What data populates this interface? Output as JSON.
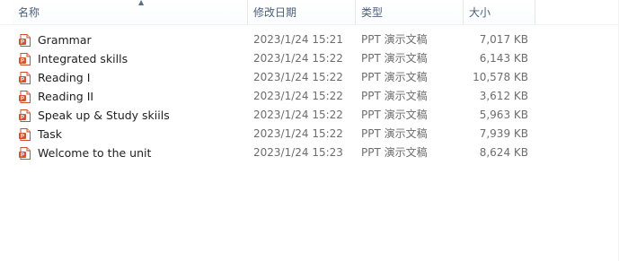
{
  "columns": {
    "name": "名称",
    "date": "修改日期",
    "type": "类型",
    "size": "大小"
  },
  "icon": "powerpoint-file-icon",
  "accent_color": "#d35230",
  "files": [
    {
      "name": "Grammar",
      "date": "2023/1/24 15:21",
      "type": "PPT 演示文稿",
      "size": "7,017 KB"
    },
    {
      "name": "Integrated skills",
      "date": "2023/1/24 15:22",
      "type": "PPT 演示文稿",
      "size": "6,143 KB"
    },
    {
      "name": "Reading I",
      "date": "2023/1/24 15:22",
      "type": "PPT 演示文稿",
      "size": "10,578 KB"
    },
    {
      "name": "Reading II",
      "date": "2023/1/24 15:22",
      "type": "PPT 演示文稿",
      "size": "3,612 KB"
    },
    {
      "name": "Speak up & Study skiils",
      "date": "2023/1/24 15:22",
      "type": "PPT 演示文稿",
      "size": "5,963 KB"
    },
    {
      "name": "Task",
      "date": "2023/1/24 15:22",
      "type": "PPT 演示文稿",
      "size": "7,939 KB"
    },
    {
      "name": "Welcome to the unit",
      "date": "2023/1/24 15:23",
      "type": "PPT 演示文稿",
      "size": "8,624 KB"
    }
  ]
}
